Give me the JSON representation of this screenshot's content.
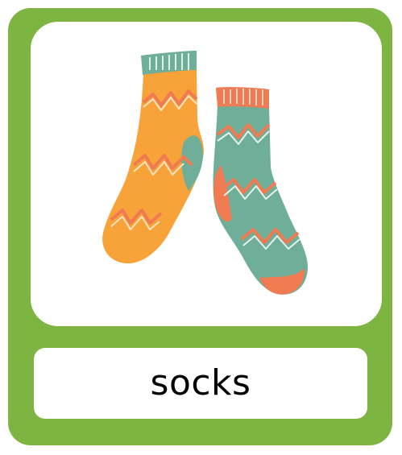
{
  "card": {
    "word": "socks",
    "image_subject": "socks-illustration-icon"
  },
  "colors": {
    "frame": "#7db442",
    "panel": "#ffffff",
    "sock_orange": "#f7a33a",
    "sock_teal": "#6fae98",
    "accent_coral": "#f07a52",
    "cuff_teal": "#6fae98",
    "cuff_coral": "#f07a52"
  }
}
